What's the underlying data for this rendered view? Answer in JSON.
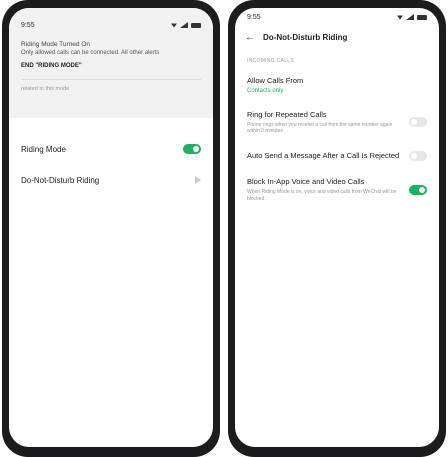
{
  "status": {
    "time": "9:55"
  },
  "left": {
    "notif_title": "Riding Mode Turned On",
    "notif_body": "Only allowed calls can be connected. All other alerts",
    "notif_action": "END \"RIDING MODE\"",
    "notif_footer": "related to this mode",
    "riding_mode_label": "Riding Mode",
    "riding_mode_on": true,
    "dnd_riding_label": "Do-Not-Disturb Riding"
  },
  "right": {
    "header_title": "Do-Not-Disturb Riding",
    "section_label": "INCOMING CALLS",
    "allow_calls_title": "Allow Calls From",
    "allow_calls_value": "Contacts only",
    "repeat_calls_title": "Ring for Repeated Calls",
    "repeat_calls_sub": "Phone rings when you receive a call from the same number again within 3 minutes",
    "repeat_calls_on": false,
    "auto_send_title": "Auto Send a Message After a Call Is Rejected",
    "auto_send_on": false,
    "block_inapp_title": "Block In-App Voice and Video Calls",
    "block_inapp_sub": "When Riding Mode is on, voice and video calls from WeChat will be blocked",
    "block_inapp_on": true
  },
  "colors": {
    "accent": "#1fae62",
    "toggle_off": "#e6e6e6"
  }
}
